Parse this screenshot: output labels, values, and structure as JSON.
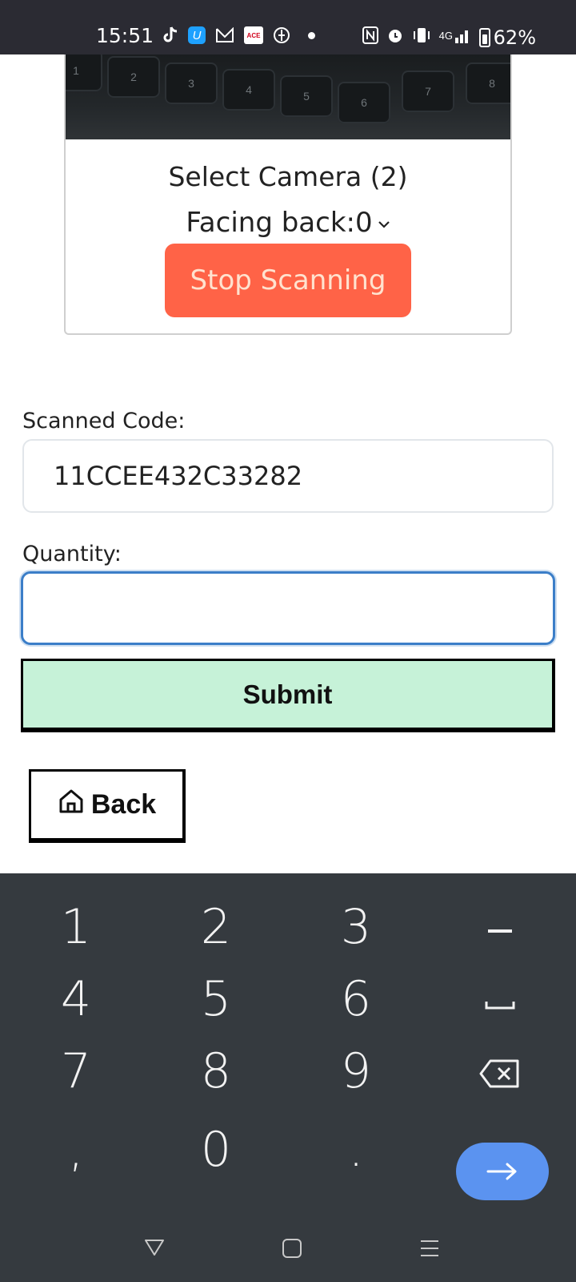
{
  "status_bar": {
    "time": "15:51",
    "network": "4G",
    "battery": "62%",
    "battery_level": 0.62,
    "icons": [
      "tiktok-icon",
      "u-app-icon",
      "mail-icon",
      "ace-app-icon",
      "p-app-icon",
      "dot-icon",
      "nfc-icon",
      "alarm-icon",
      "vibrate-icon",
      "signal-icon",
      "battery-icon"
    ]
  },
  "scanner": {
    "select_camera_label": "Select Camera (2)",
    "camera_selected": "Facing back:0",
    "stop_button_label": "Stop Scanning"
  },
  "form": {
    "scanned_code_label": "Scanned Code:",
    "scanned_code_value": "11CCEE432C33282",
    "quantity_label": "Quantity:",
    "quantity_value": "",
    "submit_label": "Submit",
    "back_label": "Back"
  },
  "keyboard": {
    "keys": [
      "1",
      "2",
      "3",
      "-",
      "4",
      "5",
      "6",
      "␣",
      "7",
      "8",
      "9",
      "⌫",
      ",",
      "0",
      "."
    ],
    "enter_icon": "arrow-right-icon"
  },
  "colors": {
    "stop_button": "#ff6347",
    "submit_button": "#c6f2d8",
    "input_focus": "#3b7ec8",
    "keyboard_bg": "#353a3f",
    "enter_key": "#5b93f0"
  }
}
